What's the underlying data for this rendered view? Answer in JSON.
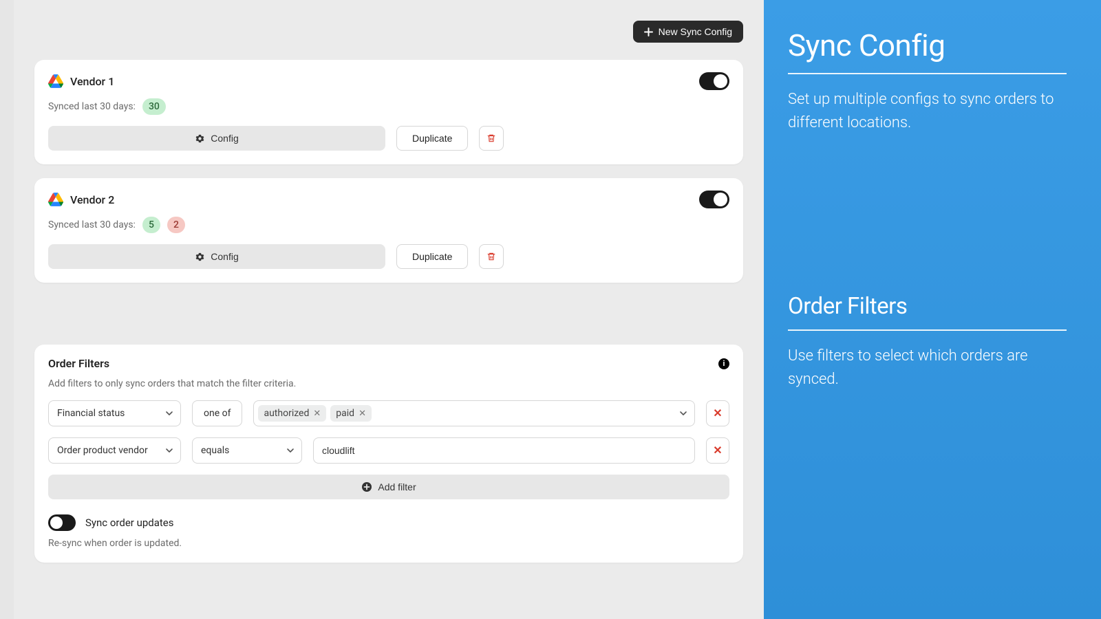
{
  "topbar": {
    "new_sync": "New Sync Config"
  },
  "vendors": [
    {
      "name": "Vendor 1",
      "synced_label": "Synced last 30 days:",
      "badges": [
        {
          "value": "30",
          "tone": "green"
        }
      ],
      "config": "Config",
      "duplicate": "Duplicate"
    },
    {
      "name": "Vendor 2",
      "synced_label": "Synced last 30 days:",
      "badges": [
        {
          "value": "5",
          "tone": "green"
        },
        {
          "value": "2",
          "tone": "red"
        }
      ],
      "config": "Config",
      "duplicate": "Duplicate"
    }
  ],
  "filters": {
    "title": "Order Filters",
    "desc": "Add filters to only sync orders that match the filter criteria.",
    "rows": [
      {
        "field": "Financial status",
        "op": "one of",
        "op_type": "static",
        "value_type": "tags",
        "tags": [
          "authorized",
          "paid"
        ]
      },
      {
        "field": "Order product vendor",
        "op": "equals",
        "op_type": "select",
        "value_type": "text",
        "value": "cloudlift"
      }
    ],
    "add_label": "Add filter",
    "sync_updates_label": "Sync order updates",
    "sync_updates_note": "Re-sync when order is updated."
  },
  "side": {
    "h1": "Sync Config",
    "p1": "Set up multiple configs to sync orders to different locations.",
    "h2": "Order Filters",
    "p2": "Use filters to select which orders are synced."
  }
}
